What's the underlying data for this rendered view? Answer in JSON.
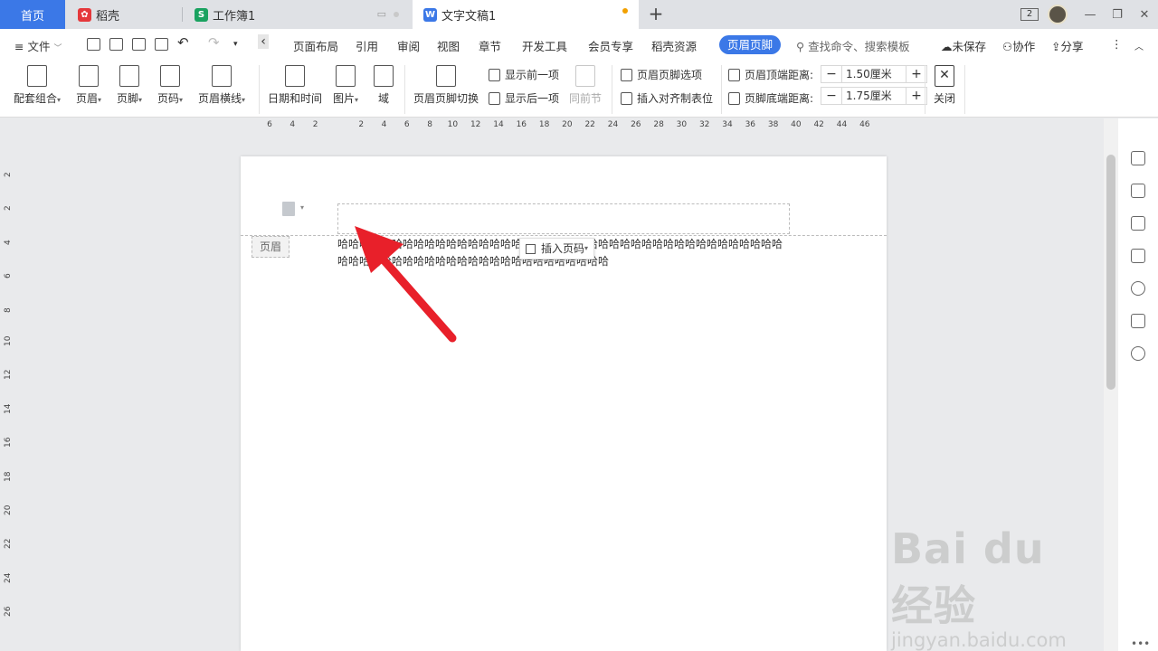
{
  "tabs": [
    {
      "label": "首页"
    },
    {
      "label": "稻壳",
      "icon": "docer-icon"
    },
    {
      "label": "工作簿1",
      "icon": "spreadsheet-icon"
    },
    {
      "label": "文字文稿1",
      "icon": "writer-icon"
    }
  ],
  "menu": {
    "file": "文件",
    "items": [
      "页面布局",
      "引用",
      "审阅",
      "视图",
      "章节",
      "开发工具",
      "会员专享",
      "稻壳资源"
    ],
    "active": "页眉页脚",
    "search": "查找命令、搜索模板",
    "unsaved": "未保存",
    "collab": "协作",
    "share": "分享"
  },
  "ribbon": {
    "combo": "配套组合",
    "header": "页眉",
    "footer": "页脚",
    "pagenum": "页码",
    "header_line": "页眉横线",
    "datetime": "日期和时间",
    "picture": "图片",
    "field": "域",
    "switch": "页眉页脚切换",
    "show_prev": "显示前一项",
    "show_next": "显示后一项",
    "same_prev": "同前节",
    "options": "页眉页脚选项",
    "align_tab": "插入对齐制表位",
    "top_label": "页眉顶端距离:",
    "top_value": "1.50厘米",
    "bottom_label": "页脚底端距离:",
    "bottom_value": "1.75厘米",
    "close": "关闭"
  },
  "hruler_ticks": [
    "6",
    "4",
    "2",
    "",
    "2",
    "4",
    "6",
    "8",
    "10",
    "12",
    "14",
    "16",
    "18",
    "20",
    "22",
    "24",
    "26",
    "28",
    "30",
    "32",
    "34",
    "36",
    "38",
    "40",
    "42",
    "44",
    "46"
  ],
  "vruler_ticks": [
    "2",
    "2",
    "4",
    "6",
    "8",
    "10",
    "12",
    "14",
    "16",
    "18",
    "20",
    "22",
    "24",
    "26"
  ],
  "page": {
    "header_tag": "页眉",
    "body_text": "哈哈哈哈哈哈哈哈哈哈哈哈哈哈哈哈哈哈哈哈哈哈哈哈哈哈哈哈哈哈哈哈哈哈哈哈哈哈哈哈哈哈哈哈哈哈哈哈哈哈哈哈哈哈哈哈哈哈哈哈哈哈哈哈哈哈",
    "insert_page_number": "插入页码"
  },
  "watermark": {
    "brand": "Bai du 经验",
    "url": "jingyan.baidu.com"
  },
  "colors": {
    "accent": "#3b78e7",
    "arrow": "#e8202a"
  }
}
